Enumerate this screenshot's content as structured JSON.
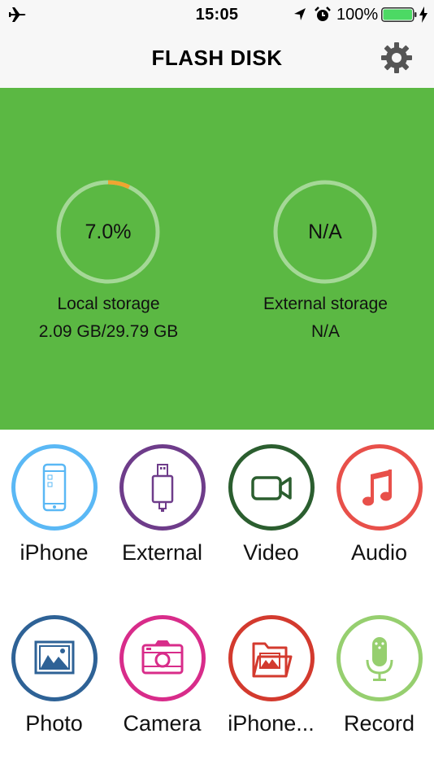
{
  "status_bar": {
    "time": "15:05",
    "battery_percent": "100%",
    "battery_level": 1.0,
    "icons": [
      "airplane-icon",
      "location-arrow-icon",
      "alarm-clock-icon",
      "battery-icon",
      "charging-bolt-icon"
    ]
  },
  "nav": {
    "title": "FLASH DISK",
    "settings_icon": "gear-icon"
  },
  "storage": {
    "background_color": "#5bb843",
    "local": {
      "percent_text": "7.0%",
      "used_fraction": 0.07,
      "label": "Local storage",
      "value": "2.09 GB/29.79 GB",
      "progress_color": "#f0a531"
    },
    "external": {
      "percent_text": "N/A",
      "used_fraction": 0,
      "label": "External storage",
      "value": "N/A"
    }
  },
  "tiles": [
    {
      "label": "iPhone",
      "icon": "iphone-icon",
      "color": "#5ab8f5"
    },
    {
      "label": "External",
      "icon": "usb-drive-icon",
      "color": "#6e3c8a"
    },
    {
      "label": "Video",
      "icon": "video-camera-icon",
      "color": "#2b5e2f"
    },
    {
      "label": "Audio",
      "icon": "music-note-icon",
      "color": "#e8504a"
    },
    {
      "label": "Photo",
      "icon": "photo-icon",
      "color": "#2e6296"
    },
    {
      "label": "Camera",
      "icon": "camera-icon",
      "color": "#d82c8a"
    },
    {
      "label": "iPhone...",
      "icon": "folder-photo-icon",
      "color": "#d33a2e"
    },
    {
      "label": "Record",
      "icon": "microphone-icon",
      "color": "#96cf6f"
    }
  ]
}
